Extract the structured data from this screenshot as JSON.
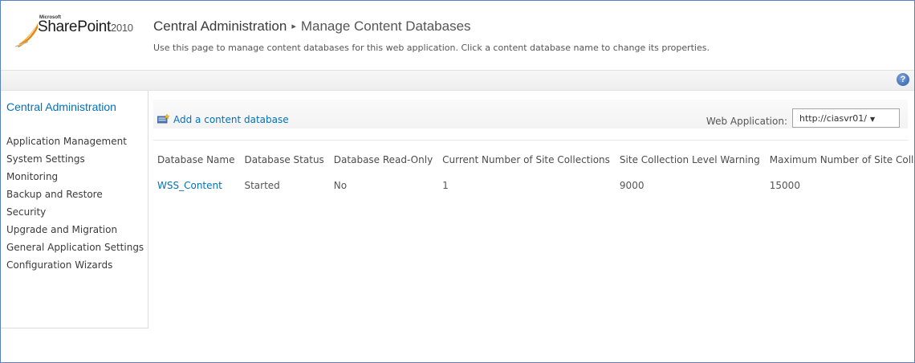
{
  "header": {
    "logo": {
      "company": "Microsoft",
      "product": "SharePoint",
      "version": "2010"
    },
    "breadcrumb_root": "Central Administration",
    "breadcrumb_separator": "▸",
    "page_title": "Manage Content Databases",
    "description": "Use this page to manage content databases for this web application. Click a content database name to change its properties."
  },
  "help": {
    "icon": "help-icon",
    "glyph": "?"
  },
  "sidebar": {
    "home": "Central Administration",
    "items": [
      {
        "label": "Application Management"
      },
      {
        "label": "System Settings"
      },
      {
        "label": "Monitoring"
      },
      {
        "label": "Backup and Restore"
      },
      {
        "label": "Security"
      },
      {
        "label": "Upgrade and Migration"
      },
      {
        "label": "General Application Settings"
      },
      {
        "label": "Configuration Wizards"
      }
    ]
  },
  "toolbar": {
    "add_label": "Add a content database",
    "add_icon": "database-add-icon",
    "web_app_label": "Web Application:",
    "web_app_value": "http://ciasvr01/"
  },
  "table": {
    "headers": [
      "Database Name",
      "Database Status",
      "Database Read-Only",
      "Current Number of Site Collections",
      "Site Collection Level Warning",
      "Maximum Number of Site Collections"
    ],
    "rows": [
      {
        "name": "WSS_Content",
        "status": "Started",
        "read_only": "No",
        "current": "1",
        "warning": "9000",
        "maximum": "15000"
      }
    ]
  },
  "colors": {
    "link": "#0072bc",
    "frame_border": "#5b7fc7",
    "text": "#555555"
  }
}
